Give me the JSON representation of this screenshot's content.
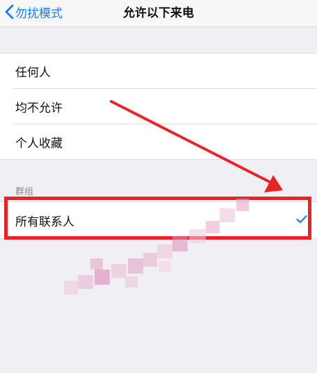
{
  "navbar": {
    "back_label": "勿扰模式",
    "title": "允许以下来电"
  },
  "options": [
    {
      "label": "任何人"
    },
    {
      "label": "均不允许"
    },
    {
      "label": "个人收藏"
    }
  ],
  "groups_section": {
    "header": "群组",
    "items": [
      {
        "label": "所有联系人",
        "selected": true
      }
    ]
  },
  "colors": {
    "accent": "#1a7cf5",
    "annotation": "#e8242a",
    "background": "#efeff4"
  },
  "icons": {
    "back": "chevron-left-icon",
    "selected": "checkmark-icon"
  }
}
